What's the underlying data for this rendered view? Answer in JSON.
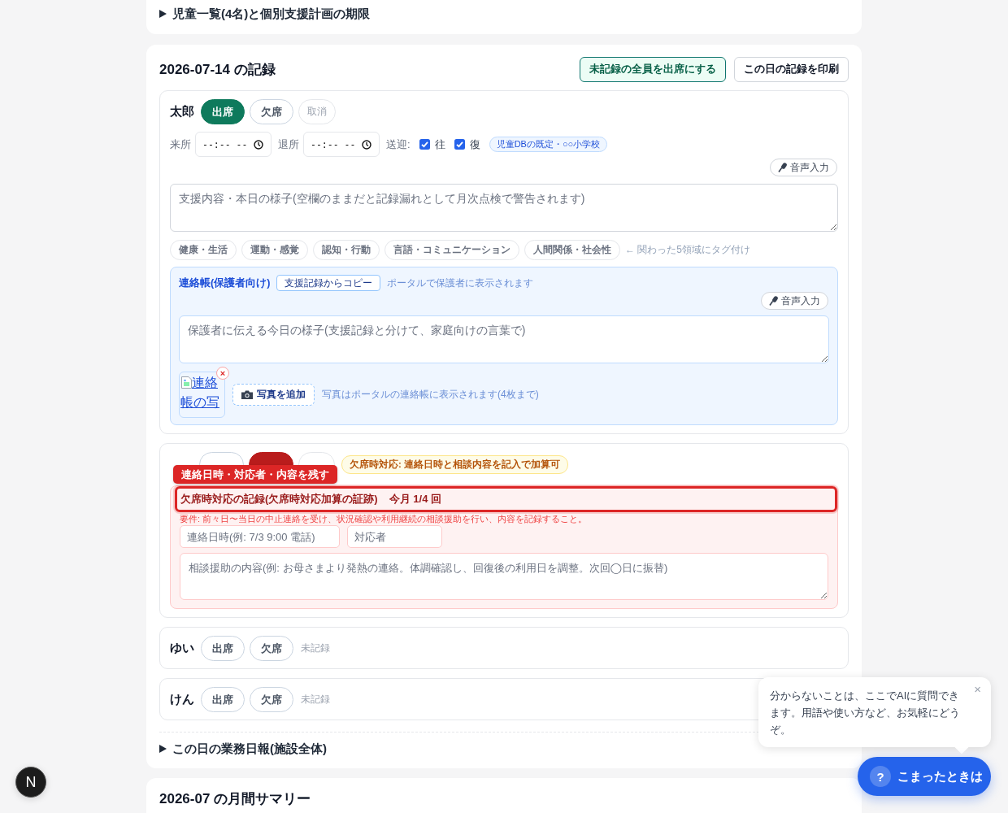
{
  "top_section": {
    "title": "児童一覧(4名)と個別支援計画の期限",
    "expanded": false
  },
  "day_record": {
    "title": "2026-07-14 の記録",
    "actions": [
      {
        "label": "未記録の全員を出席にする",
        "kind": "primary"
      },
      {
        "label": "この日の記録を印刷",
        "kind": "secondary"
      }
    ],
    "children": [
      {
        "name": "太郎",
        "attendance": [
          {
            "kind": "present",
            "label": "出席",
            "selected": true
          },
          {
            "kind": "absent",
            "label": "欠席",
            "selected": false
          },
          {
            "kind": "cancel",
            "label": "取消",
            "selected": false
          }
        ],
        "times": [
          {
            "label": "来所",
            "placeholder": "--:-- --"
          },
          {
            "label": "退所",
            "placeholder": "--:-- --"
          }
        ],
        "transport": {
          "label": "送迎:",
          "options": [
            {
              "label": "往",
              "checked": true
            },
            {
              "label": "復",
              "checked": true
            }
          ],
          "badge": "児童DBの既定・○○小学校"
        },
        "voice_button": "音声入力",
        "support_note": {
          "placeholder": "支援内容・本日の様子(空欄のままだと記録漏れとして月次点検で警告されます)"
        },
        "domain_tags": [
          {
            "label": "健康・生活",
            "selected": false
          },
          {
            "label": "運動・感覚",
            "selected": false
          },
          {
            "label": "認知・行動",
            "selected": false
          },
          {
            "label": "言語・コミュニケーション",
            "selected": false
          },
          {
            "label": "人間関係・社会性",
            "selected": false
          }
        ],
        "tag_hint": "← 関わった5領域にタグ付け",
        "contact_book": {
          "title": "連絡帳(保護者向け)",
          "copy_button": "支援記録からコピー",
          "hint": "ポータルで保護者に表示されます",
          "voice_button": "音声入力",
          "placeholder": "保護者に伝える今日の様子(支援記録と分けて、家庭向けの言葉で)",
          "photos": [
            {
              "alt": "連絡帳の写",
              "remove": "×"
            }
          ],
          "add_photo": "写真を追加",
          "photo_hint": "写真はポータルの連絡帳に表示されます(4枚まで)"
        }
      },
      {
        "attendance": [
          {
            "kind": "present",
            "selected": false
          },
          {
            "kind": "absent",
            "selected": true
          },
          {
            "kind": "cancel",
            "selected": false
          }
        ],
        "badge": "欠席時対応: 連絡日時と相談内容を記入で加算可",
        "callout": "連絡日時・対応者・内容を残す",
        "absence_record": {
          "title": "欠席時対応の記録(欠席時対応加算の証跡)",
          "count": "今月 1/4 回",
          "highlighted": true,
          "requirement": "要件: 前々日〜当日の中止連絡を受け、状況確認や利用継続の相談援助を行い、内容を記録すること。",
          "contact_time": {
            "placeholder": "連絡日時(例: 7/3 9:00 電話)"
          },
          "responder": {
            "placeholder": "対応者"
          },
          "consultation": {
            "placeholder": "相談援助の内容(例: お母さまより発熱の連絡。体調確認し、回復後の利用日を調整。次回◯日に振替)"
          }
        }
      },
      {
        "name": "ゆい",
        "attendance": [
          {
            "kind": "present",
            "label": "出席",
            "selected": false
          },
          {
            "kind": "absent",
            "label": "欠席",
            "selected": false
          }
        ],
        "status": "未記録"
      },
      {
        "name": "けん",
        "attendance": [
          {
            "kind": "present",
            "label": "出席",
            "selected": false
          },
          {
            "kind": "absent",
            "label": "欠席",
            "selected": false
          }
        ],
        "status": "未記録"
      }
    ],
    "daily_report": {
      "title": "この日の業務日報(施設全体)",
      "expanded": false
    }
  },
  "monthly_summary": {
    "title": "2026-07 の月間サマリー"
  },
  "dev_indicator": {
    "label": "N"
  },
  "help": {
    "message": "分からないことは、ここでAIに質問できます。用語や使い方など、お気軽にどうぞ。",
    "close": "×",
    "icon": "?",
    "button": "こまったときは"
  }
}
